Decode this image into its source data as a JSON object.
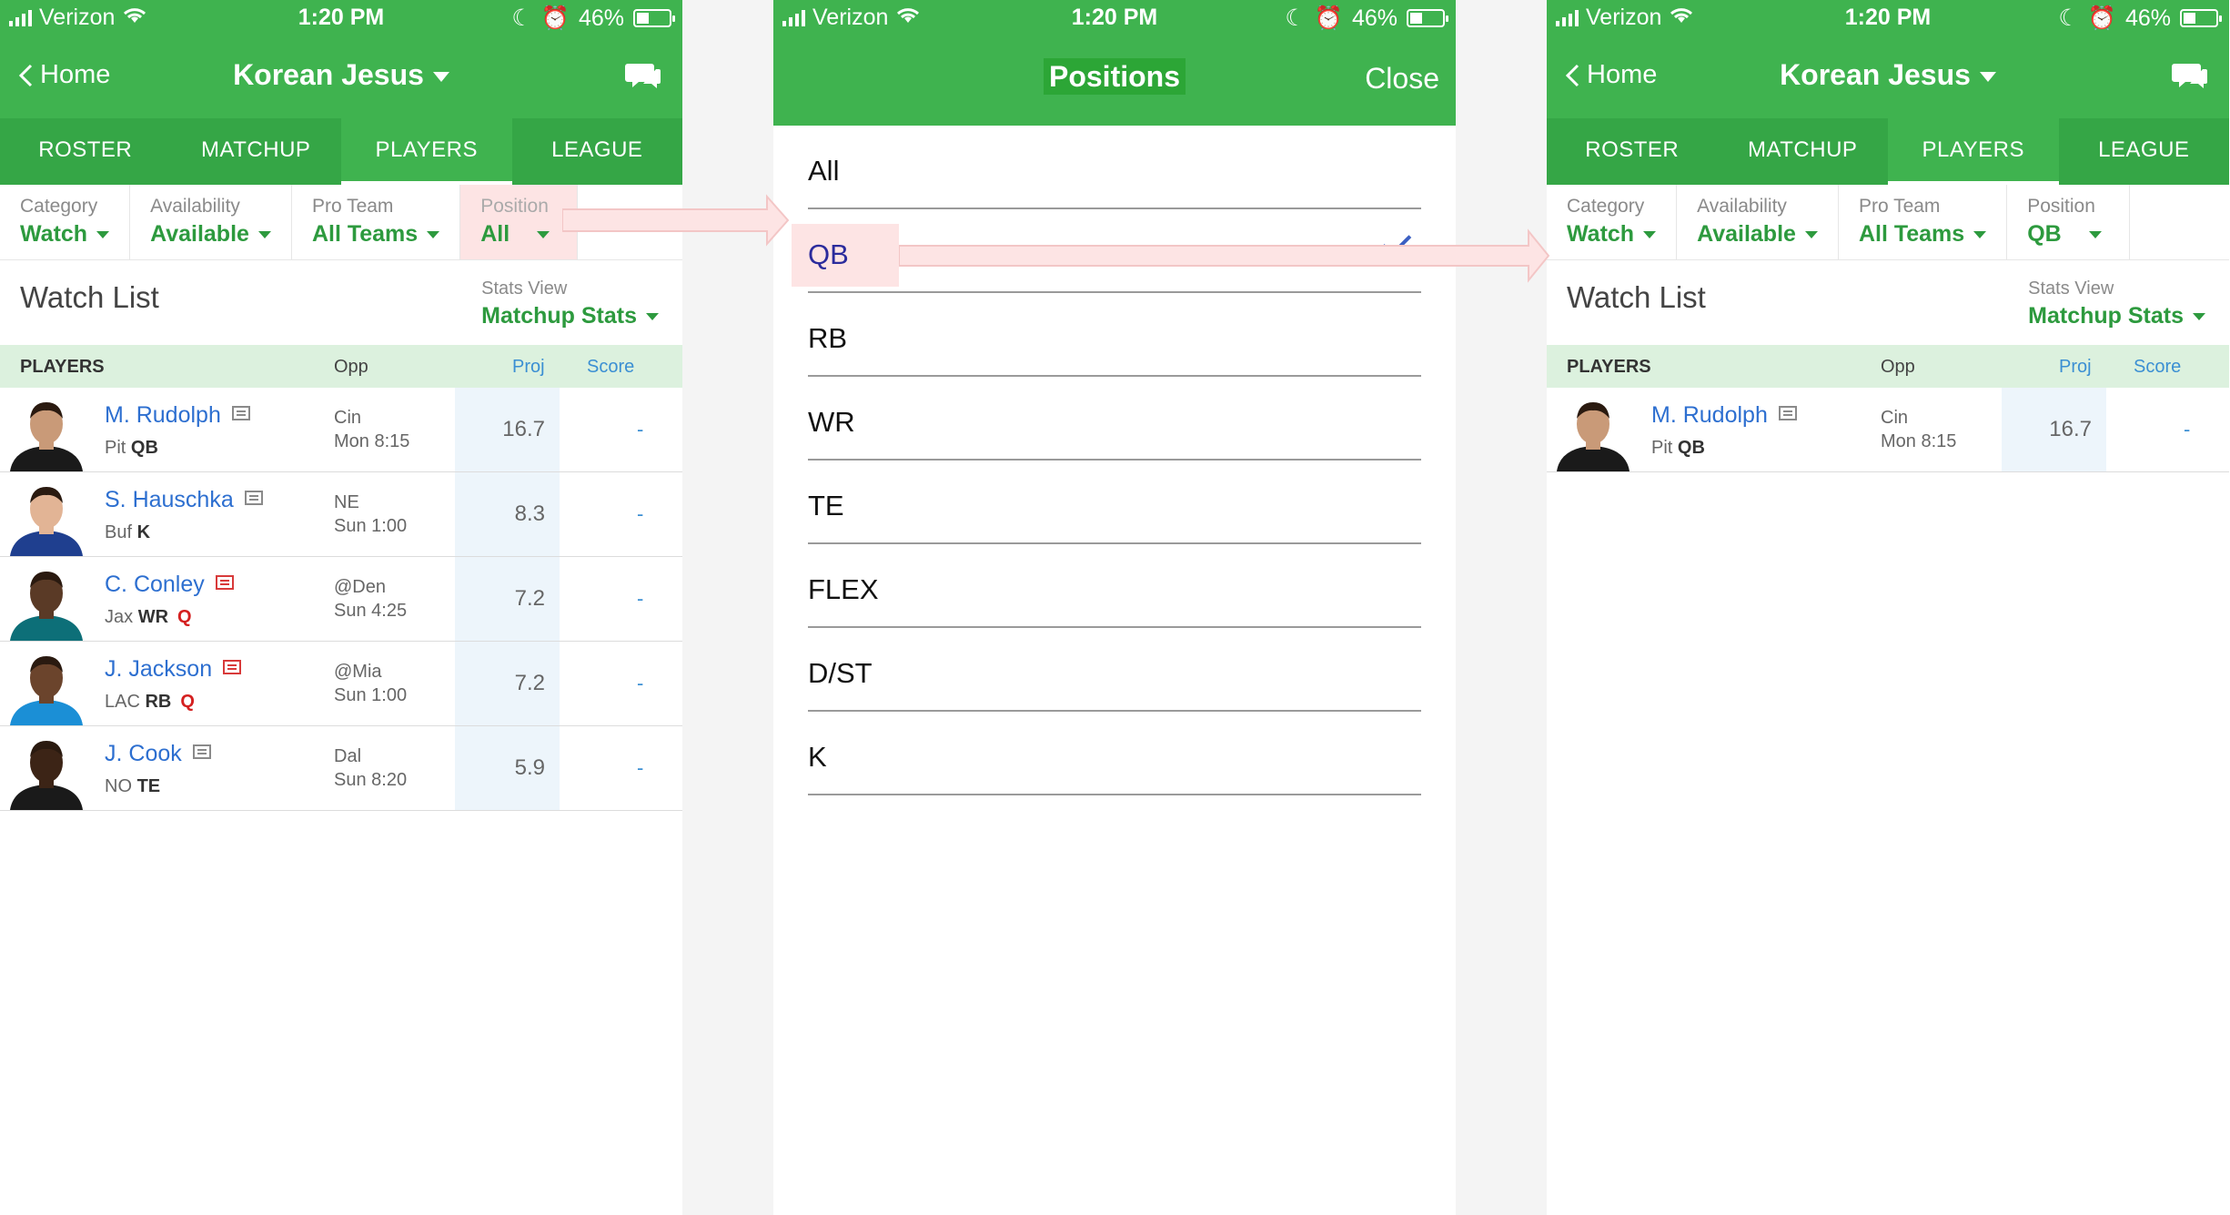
{
  "status_bar": {
    "carrier": "Verizon",
    "time": "1:20 PM",
    "battery": "46%",
    "battery_level": 0.46
  },
  "app_nav": {
    "back_label": "Home",
    "team_name": "Korean Jesus"
  },
  "tabs": [
    "ROSTER",
    "MATCHUP",
    "PLAYERS",
    "LEAGUE"
  ],
  "active_tab": "PLAYERS",
  "filters_before": {
    "category_label": "Category",
    "category_value": "Watch",
    "availability_label": "Availability",
    "availability_value": "Available",
    "proteam_label": "Pro Team",
    "proteam_value": "All Teams",
    "position_label": "Position",
    "position_value": "All"
  },
  "filters_after": {
    "category_label": "Category",
    "category_value": "Watch",
    "availability_label": "Availability",
    "availability_value": "Available",
    "proteam_label": "Pro Team",
    "proteam_value": "All Teams",
    "position_label": "Position",
    "position_value": "QB"
  },
  "watch_list": {
    "title": "Watch List",
    "stats_view_label": "Stats View",
    "stats_view_value": "Matchup Stats"
  },
  "table_header": {
    "players": "PLAYERS",
    "opp": "Opp",
    "proj": "Proj",
    "score": "Score"
  },
  "players_before": [
    {
      "name": "M. Rudolph",
      "team": "Pit",
      "pos": "QB",
      "injury": "",
      "opp": "Cin",
      "time": "Mon 8:15",
      "proj": "16.7",
      "score": "-",
      "news_hot": false,
      "jersey": "#1a1a1a",
      "skin": "#c99a78"
    },
    {
      "name": "S. Hauschka",
      "team": "Buf",
      "pos": "K",
      "injury": "",
      "opp": "NE",
      "time": "Sun 1:00",
      "proj": "8.3",
      "score": "-",
      "news_hot": false,
      "jersey": "#1f3f8f",
      "skin": "#e2b495"
    },
    {
      "name": "C. Conley",
      "team": "Jax",
      "pos": "WR",
      "injury": "Q",
      "opp": "@Den",
      "time": "Sun 4:25",
      "proj": "7.2",
      "score": "-",
      "news_hot": true,
      "jersey": "#0d6f78",
      "skin": "#5a3a26"
    },
    {
      "name": "J. Jackson",
      "team": "LAC",
      "pos": "RB",
      "injury": "Q",
      "opp": "@Mia",
      "time": "Sun 1:00",
      "proj": "7.2",
      "score": "-",
      "news_hot": true,
      "jersey": "#1b8fd6",
      "skin": "#6b442c"
    },
    {
      "name": "J. Cook",
      "team": "NO",
      "pos": "TE",
      "injury": "",
      "opp": "Dal",
      "time": "Sun 8:20",
      "proj": "5.9",
      "score": "-",
      "news_hot": false,
      "jersey": "#1a1a1a",
      "skin": "#3c2416"
    }
  ],
  "players_after": [
    {
      "name": "M. Rudolph",
      "team": "Pit",
      "pos": "QB",
      "injury": "",
      "opp": "Cin",
      "time": "Mon 8:15",
      "proj": "16.7",
      "score": "-",
      "news_hot": false,
      "jersey": "#1a1a1a",
      "skin": "#c99a78"
    }
  ],
  "positions_modal": {
    "title": "Positions",
    "close_label": "Close",
    "options": [
      "All",
      "QB",
      "RB",
      "WR",
      "TE",
      "FLEX",
      "D/ST",
      "K"
    ],
    "selected": "QB"
  },
  "colors": {
    "brand_green": "#3fb34f",
    "tab_green": "#35a646",
    "link_blue": "#2d6fd0",
    "highlight_pink": "#fde4e4"
  }
}
